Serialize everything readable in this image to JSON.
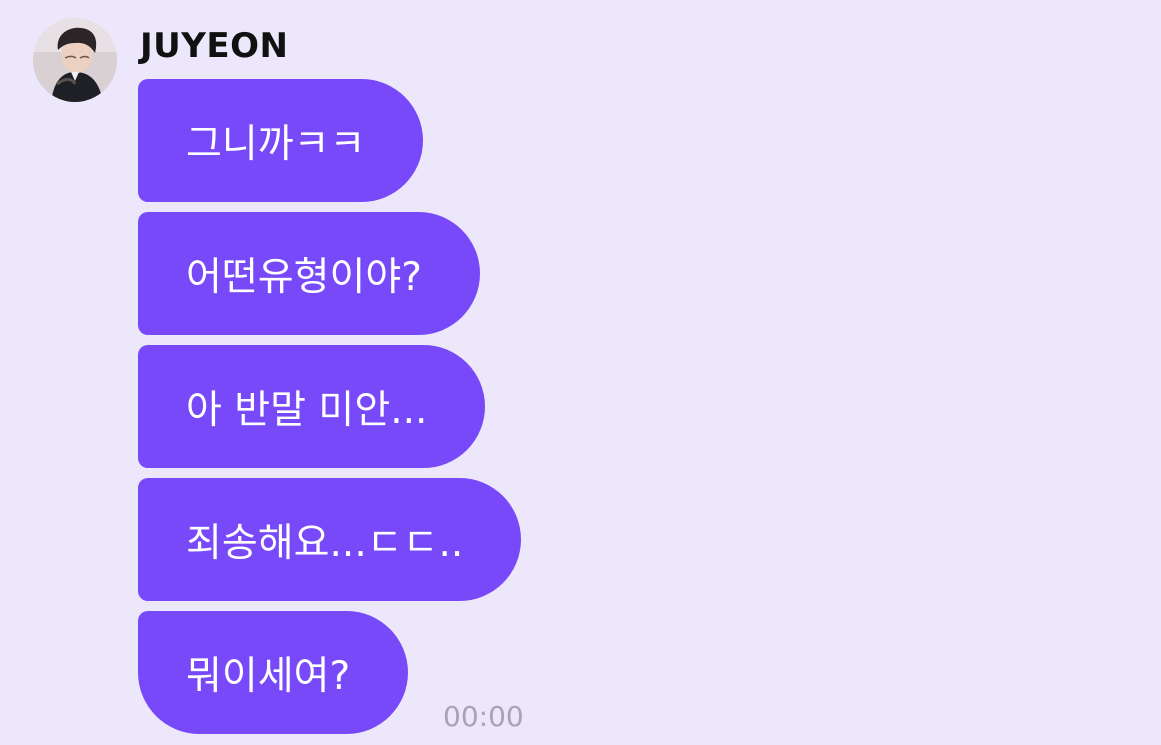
{
  "sender": {
    "name": "JUYEON",
    "avatar_icon": "profile-photo"
  },
  "messages": [
    {
      "text": "그니까ㅋㅋ"
    },
    {
      "text": "어떤유형이야?"
    },
    {
      "text": "아 반말 미안..."
    },
    {
      "text": "죄송해요...ㄷㄷ.."
    },
    {
      "text": "뭐이세여?"
    }
  ],
  "timestamp": "00:00",
  "colors": {
    "background": "#ede7fb",
    "bubble": "#7749f8",
    "bubble_text": "#ffffff",
    "name_text": "#111111",
    "timestamp_text": "#a8a4b3"
  }
}
